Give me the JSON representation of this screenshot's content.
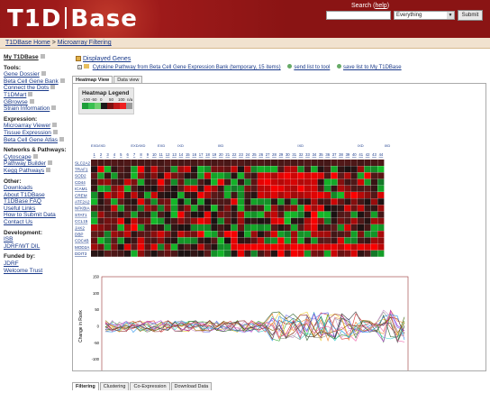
{
  "header": {
    "logo_left": "T1D",
    "logo_right": "Base",
    "search_label": "Search",
    "help_link": "help",
    "search_value": "",
    "search_scope": "Everything",
    "submit_label": "Submit"
  },
  "breadcrumb": {
    "home": "T1DBase Home",
    "sep": ">",
    "current": "Microarray Filtering"
  },
  "sidebar": {
    "my": "My T1DBase",
    "tools_h": "Tools:",
    "tools": [
      "Gene Dossier",
      "Beta Cell Gene Bank",
      "Connect the Dots",
      "T1DMart",
      "GBrowse",
      "Strain Information"
    ],
    "expr_h": "Expression:",
    "expr": [
      "Microarray Viewer",
      "Tissue Expression",
      "Beta Cell Gene Atlas"
    ],
    "net_h": "Networks & Pathways:",
    "net": [
      "Cytoscape",
      "Pathway Builder",
      "Kegg Pathways"
    ],
    "other_h": "Other:",
    "other": [
      "Downloads",
      "About T1DBase",
      "T1DBase FAQ",
      "Useful Links",
      "How to Submit Data",
      "Contact Us"
    ],
    "dev_h": "Development:",
    "dev": [
      "ISB",
      "JDRF/WT DIL"
    ],
    "fund_h": "Funded by:",
    "fund": [
      "JDRF",
      "Welcome Trust"
    ]
  },
  "main": {
    "displayed_genes": "Displayed Genes",
    "pathway": "Cytokine Pathway from Beta Cell Gene Expression Bank (temporary, 15 items)",
    "send_tool": "send list to tool",
    "save_list": "save list to My T1DBase",
    "tab_heatmap": "Heatmap View",
    "tab_data": "Data view",
    "legend_title": "Heatmap Legend",
    "legend_ticks": [
      "-100",
      "-50",
      "0",
      "50",
      "100",
      "n/a"
    ],
    "bottom_tabs": [
      "Filtering",
      "Clustering",
      "Co-Expression",
      "Download Data"
    ]
  },
  "colors": {
    "header": "#9e1a1a",
    "crumb_bg": "#f1e2cf",
    "link": "#1a3a8a"
  },
  "chart_data": {
    "type": "heatmap",
    "genes": [
      "SLC2A2",
      "TRAF1",
      "SOD2",
      "CD44",
      "ICAM1",
      "CREM",
      "ATF2A2",
      "NFKBIA",
      "STAT1",
      "CCL15",
      "JAK2",
      "DBP",
      "CDC4B",
      "MOD2A",
      "DDIT3"
    ],
    "columns": [
      "1",
      "2",
      "3",
      "4",
      "5",
      "6",
      "7",
      "8",
      "9",
      "10",
      "11",
      "12",
      "13",
      "14",
      "15",
      "16",
      "17",
      "18",
      "19",
      "20",
      "21",
      "22",
      "23",
      "24",
      "25",
      "26",
      "27",
      "28",
      "29",
      "30",
      "31",
      "32",
      "33",
      "34",
      "35",
      "36",
      "37",
      "38",
      "39",
      "40",
      "41",
      "42",
      "43",
      "44"
    ],
    "col_groups": [
      "EXD/IXD",
      "EXD/IXD",
      "EXD",
      "IXD",
      "IXD",
      "IXD",
      "IXD",
      "IXD"
    ],
    "line": {
      "ylabel": "Change in Rank",
      "xlabel": "Treatments",
      "ylim": [
        -150,
        150
      ],
      "yticks": [
        "150",
        "100",
        "50",
        "0",
        "-50",
        "-100",
        "-150"
      ]
    },
    "series": [
      {
        "name": "SLC2A2",
        "color": "#d33"
      },
      {
        "name": "TRAF1",
        "color": "#3a3"
      },
      {
        "name": "SOD2",
        "color": "#66e"
      },
      {
        "name": "CD44",
        "color": "#ec3"
      },
      {
        "name": "ICAM1",
        "color": "#3cc"
      },
      {
        "name": "CREM",
        "color": "#999"
      },
      {
        "name": "ATF2A2",
        "color": "#e83"
      },
      {
        "name": "NFKBIA",
        "color": "#a3c"
      },
      {
        "name": "STAT1",
        "color": "#363"
      },
      {
        "name": "CCL15",
        "color": "#39e"
      },
      {
        "name": "JAK2",
        "color": "#c9c"
      },
      {
        "name": "DBP",
        "color": "#960"
      },
      {
        "name": "CDC4B",
        "color": "#444"
      },
      {
        "name": "MOD2A",
        "color": "#e6a"
      },
      {
        "name": "DDIT3",
        "color": "#933"
      }
    ]
  }
}
